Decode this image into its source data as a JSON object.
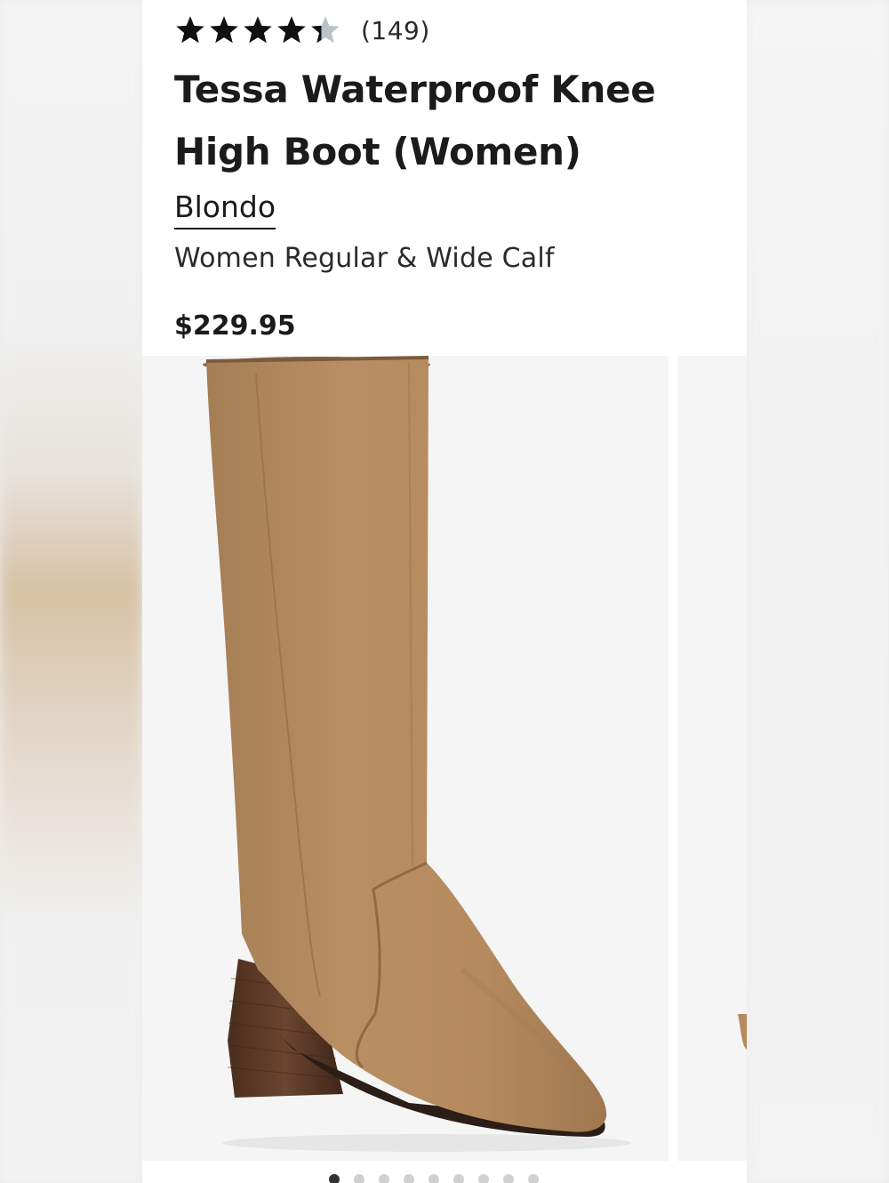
{
  "product": {
    "rating": 4.5,
    "rating_max": 5,
    "review_count": "(149)",
    "title": "Tessa Waterproof Knee High Boot (Women)",
    "brand": "Blondo",
    "subtitle": "Women Regular & Wide Calf",
    "price": "$229.95"
  },
  "gallery": {
    "image_count": 9,
    "current_index": 1
  },
  "colors": {
    "text": "#1b1b1b",
    "star_filled": "#111111",
    "star_empty": "#b9c3c9",
    "boot_suede": "#b48c61",
    "heel_wood": "#5b3a26"
  }
}
